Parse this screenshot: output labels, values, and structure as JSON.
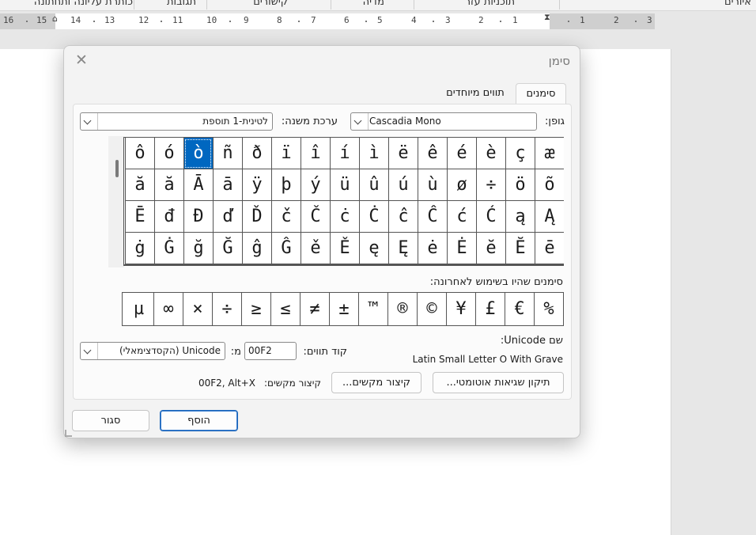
{
  "ribbon": {
    "tabs": [
      "איורים",
      "תוכניות עזר",
      "מדיה",
      "קישורים",
      "תגובות",
      "כותרת עליונה ותחתונה"
    ]
  },
  "ruler": {
    "numbers": [
      "16",
      "15",
      "14",
      "13",
      "12",
      "11",
      "10",
      "9",
      "8",
      "7",
      "6",
      "5",
      "4",
      "3",
      "2",
      "1",
      "1",
      "2",
      "3"
    ]
  },
  "dialog": {
    "title": "סימן",
    "close_icon": "close-icon",
    "tabs": [
      {
        "label": "סימנים",
        "active": true
      },
      {
        "label": "תווים מיוחדים",
        "active": false
      }
    ],
    "font_label": "גופן:",
    "font_value": "Cascadia Mono",
    "subset_label": "ערכת משנה:",
    "subset_value": "לטינית-1 תוספת",
    "symbols": [
      "æ",
      "ç",
      "è",
      "é",
      "ê",
      "ë",
      "ì",
      "í",
      "î",
      "ï",
      "ð",
      "ñ",
      "ò",
      "ó",
      "ô",
      "õ",
      "ö",
      "÷",
      "ø",
      "ù",
      "ú",
      "û",
      "ü",
      "ý",
      "þ",
      "ÿ",
      "ā",
      "Ā",
      "ă",
      "ă",
      "Ą",
      "ą",
      "Ć",
      "ć",
      "Ĉ",
      "ĉ",
      "Ċ",
      "ċ",
      "Č",
      "č",
      "Ď",
      "ď",
      "Đ",
      "đ",
      "Ē",
      "ē",
      "Ĕ",
      "ĕ",
      "Ė",
      "ė",
      "Ę",
      "ę",
      "Ě",
      "ě",
      "Ĝ",
      "ĝ",
      "Ğ",
      "ğ",
      "Ġ",
      "ġ"
    ],
    "selected_symbol": "ò",
    "recent_label": "סימנים שהיו בשימוש לאחרונה:",
    "recent_symbols": [
      "%",
      "€",
      "£",
      "¥",
      "©",
      "®",
      "™",
      "±",
      "≠",
      "≥",
      "≤",
      "÷",
      "×",
      "∞",
      "µ"
    ],
    "unicode_name_label": "שם Unicode:",
    "unicode_name_value": "Latin Small Letter O With Grave",
    "char_code_label": "קוד תווים:",
    "char_code_value": "00F2",
    "from_label": "מ:",
    "from_value": "Unicode (הקסדצימאלי)",
    "autocorrect_button": "תיקון שגיאות אוטומטי...",
    "shortcut_button": "קיצור מקשים...",
    "shortcut_label": "קיצור מקשים:",
    "shortcut_value": "00F2, Alt+X",
    "insert_button": "הוסף",
    "close_button": "סגור"
  }
}
